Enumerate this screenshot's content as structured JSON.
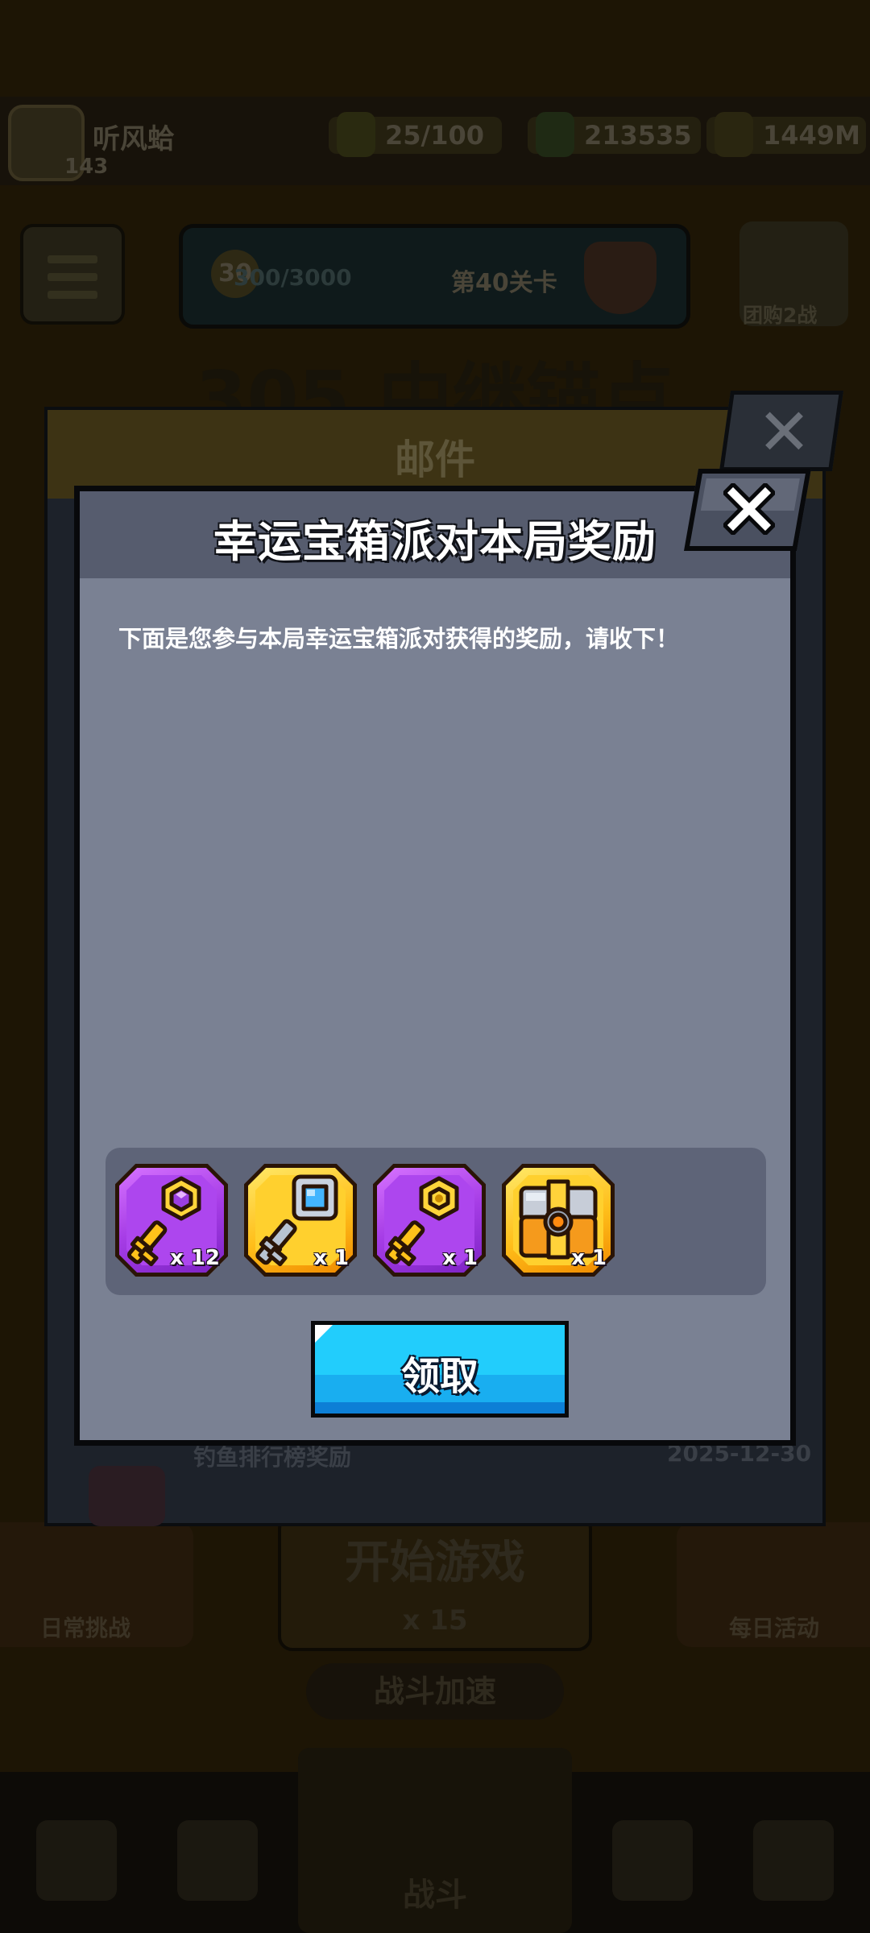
{
  "background": {
    "player_name": "听风蛤",
    "player_level": "143",
    "resources": [
      {
        "icon": "energy-icon",
        "value": "25/100"
      },
      {
        "icon": "coin-icon",
        "value": "213535"
      },
      {
        "icon": "gem-icon",
        "value": "1449M"
      }
    ],
    "banner": {
      "badge": "30",
      "progress": "300/3000",
      "text": "第40关卡"
    },
    "team_label": "团购2战",
    "level_title": "305.中继锚点",
    "start_button": "开始游戏",
    "start_cost": "x 15",
    "daily_label": "日常挑战",
    "event_label": "每日活动",
    "speed_label": "战斗加速",
    "battle_label": "战斗"
  },
  "mail_panel": {
    "title": "邮件",
    "footer_left": "钓鱼排行榜奖励",
    "footer_right": "2025-12-30"
  },
  "popup": {
    "title": "幸运宝箱派对本局奖励",
    "description": "下面是您参与本局幸运宝箱派对获得的奖励，请收下！",
    "rewards": [
      {
        "icon": "purple-gem-key-icon",
        "frame": "purple",
        "count": "x 12"
      },
      {
        "icon": "silver-diamond-key-icon",
        "frame": "gold",
        "count": "x 1"
      },
      {
        "icon": "gold-hex-key-icon",
        "frame": "purple",
        "count": "x 1"
      },
      {
        "icon": "treasure-chest-icon",
        "frame": "gold",
        "count": "x 1"
      }
    ],
    "claim_button": "领取"
  }
}
